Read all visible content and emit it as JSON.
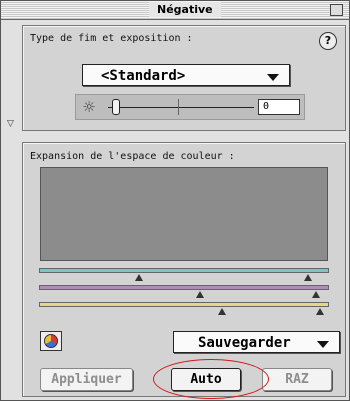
{
  "window": {
    "title": "Négative"
  },
  "film_panel": {
    "label": "Type de fim et exposition :",
    "help_icon": "?",
    "film_type": {
      "selected": "<Standard>"
    },
    "exposure": {
      "value": "0"
    }
  },
  "color_panel": {
    "label": "Expansion de l'espace de couleur :",
    "save_menu": {
      "selected": "Sauvegarder"
    },
    "buttons": {
      "apply": "Appliquer",
      "auto": "Auto",
      "reset": "RAZ"
    }
  },
  "icons": {
    "help": "help-icon",
    "exposure": "sun-icon",
    "color_picker": "color-wheel-icon",
    "collapse": "triangle-down-icon"
  },
  "colors": {
    "red_channel_bar": "#7ec6c2",
    "green_channel_bar": "#b28bbd",
    "blue_channel_bar": "#e2d78a",
    "annotation_highlight": "#d01818"
  }
}
